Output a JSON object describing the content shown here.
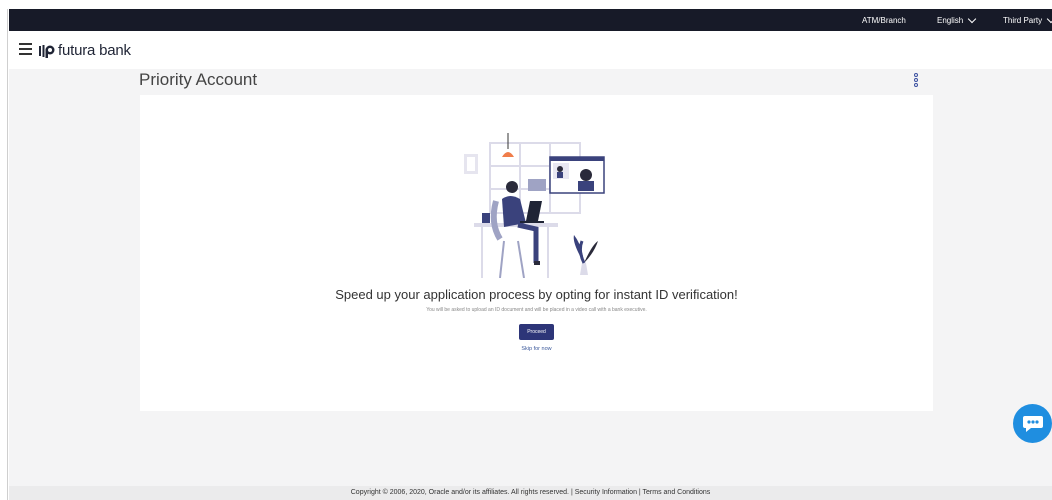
{
  "topbar": {
    "atm_branch": "ATM/Branch",
    "language": "English",
    "third_party": "Third Party"
  },
  "header": {
    "brand_name": "futura bank"
  },
  "main": {
    "title": "Priority Account",
    "headline": "Speed up your application process by opting for instant ID verification!",
    "subtext": "You will be asked to upload an ID document and will be placed in a video call with a bank executive.",
    "proceed_label": "Proceed",
    "skip_label": "Skip for now"
  },
  "footer": {
    "text": "Copyright © 2006, 2020, Oracle and/or its affiliates. All rights reserved. | Security Information | Terms and Conditions"
  },
  "colors": {
    "topbar_bg": "#171a28",
    "primary_button": "#2d3578",
    "chat_fab": "#1f8ee0",
    "link": "#3d5a9c"
  },
  "icons": [
    "hamburger-menu-icon",
    "futura-bank-logo",
    "kebab-menu-icon",
    "chevron-down-icon",
    "chatbot-icon"
  ]
}
